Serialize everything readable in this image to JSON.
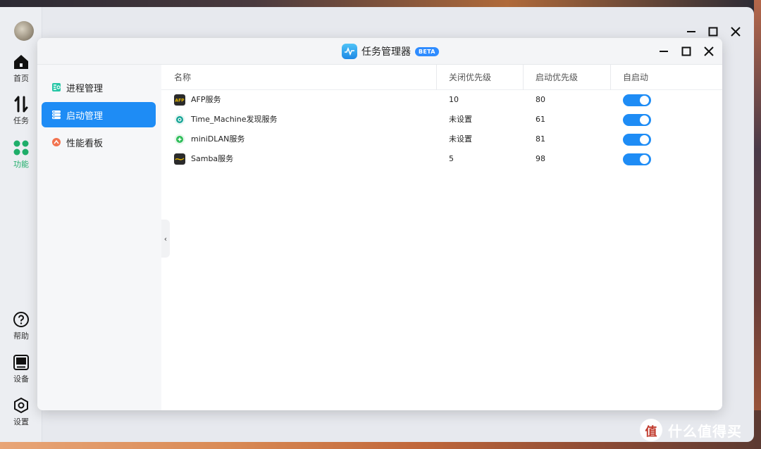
{
  "dock": {
    "items": [
      {
        "label": "首页",
        "icon": "home-icon"
      },
      {
        "label": "任务",
        "icon": "transfer-icon"
      },
      {
        "label": "功能",
        "icon": "apps-grid-icon"
      },
      {
        "label": "帮助",
        "icon": "help-icon"
      },
      {
        "label": "设备",
        "icon": "device-icon"
      },
      {
        "label": "设置",
        "icon": "settings-icon"
      }
    ],
    "active_color": "#1fae6a"
  },
  "window": {
    "title": "任务管理器",
    "badge": "BETA",
    "accent": "#1e8cf5"
  },
  "sidebar": {
    "items": [
      {
        "label": "进程管理",
        "icon": "process-icon"
      },
      {
        "label": "启动管理",
        "icon": "startup-icon",
        "active": true
      },
      {
        "label": "性能看板",
        "icon": "performance-icon"
      }
    ]
  },
  "table": {
    "columns": [
      "名称",
      "关闭优先级",
      "启动优先级",
      "自启动"
    ],
    "rows": [
      {
        "name": "AFP服务",
        "shutdown_priority": "10",
        "startup_priority": "80",
        "autostart": true,
        "icon": "afp-icon"
      },
      {
        "name": "Time_Machine发现服务",
        "shutdown_priority": "未设置",
        "startup_priority": "61",
        "autostart": true,
        "icon": "time-machine-icon"
      },
      {
        "name": "miniDLAN服务",
        "shutdown_priority": "未设置",
        "startup_priority": "81",
        "autostart": true,
        "icon": "dlna-icon"
      },
      {
        "name": "Samba服务",
        "shutdown_priority": "5",
        "startup_priority": "98",
        "autostart": true,
        "icon": "samba-icon"
      }
    ]
  },
  "watermark": {
    "logo_char": "值",
    "text": "什么值得买"
  }
}
